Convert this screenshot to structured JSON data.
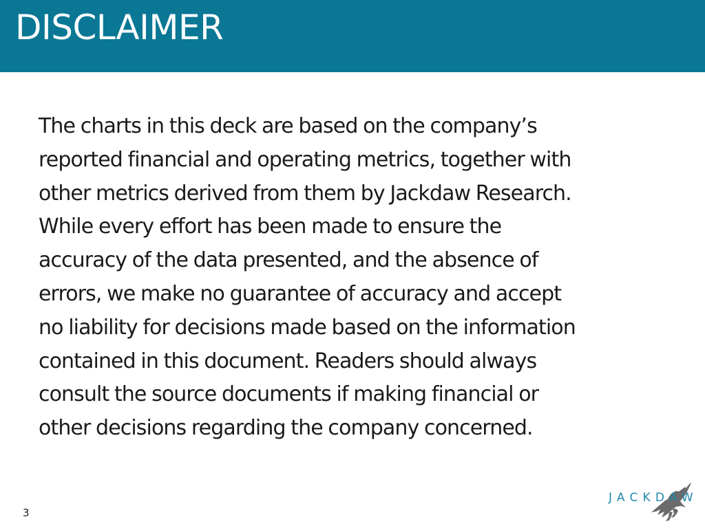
{
  "slide": {
    "title": "DISCLAIMER",
    "body_lines": [
      "The charts in this deck are based on the company’s",
      "reported financial and operating metrics, together with",
      "other metrics derived from them by Jackdaw Research.",
      "While every effort has been made to ensure the",
      "accuracy of the data presented, and the absence of",
      "errors, we make no guarantee of accuracy and accept",
      "no liability for decisions made based on the information",
      "contained in this document. Readers should always",
      "consult the source documents if making financial or",
      "other decisions regarding the company concerned."
    ],
    "page_number": "3"
  },
  "logo": {
    "wordmark": "JACKDAW",
    "icon": "jackdaw-bird-icon"
  },
  "colors": {
    "header_background": "#0a7795",
    "title_text": "#ffffff",
    "body_text": "#1a1a1a",
    "logo_text": "#1f88ab",
    "logo_bird": "#6b6b6b"
  }
}
